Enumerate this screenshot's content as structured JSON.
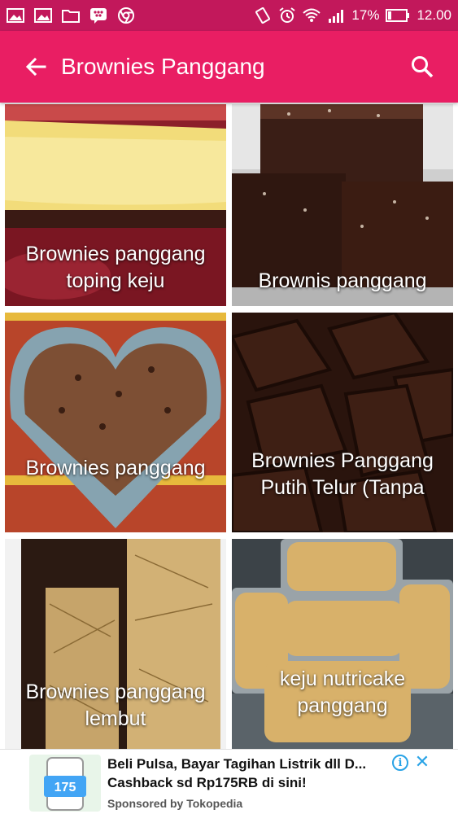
{
  "status_bar": {
    "battery_percent": "17%",
    "time": "12.00"
  },
  "app_bar": {
    "title": "Brownies Panggang"
  },
  "recipes": [
    {
      "title": "Brownies panggang toping keju"
    },
    {
      "title": "Brownis panggang"
    },
    {
      "title": "Brownies panggang"
    },
    {
      "title": "Brownies Panggang Putih Telur (Tanpa"
    },
    {
      "title": "Brownies panggang lembut"
    },
    {
      "title": "keju nutricake panggang"
    }
  ],
  "ad": {
    "text": "Beli Pulsa, Bayar Tagihan Listrik dll D... Cashback sd Rp175RB di sini!",
    "sponsor": "Sponsored by Tokopedia",
    "thumb_label": "175"
  },
  "colors": {
    "status_bar": "#c2185b",
    "app_bar": "#e91e63",
    "ad_accent": "#29a3e6"
  }
}
